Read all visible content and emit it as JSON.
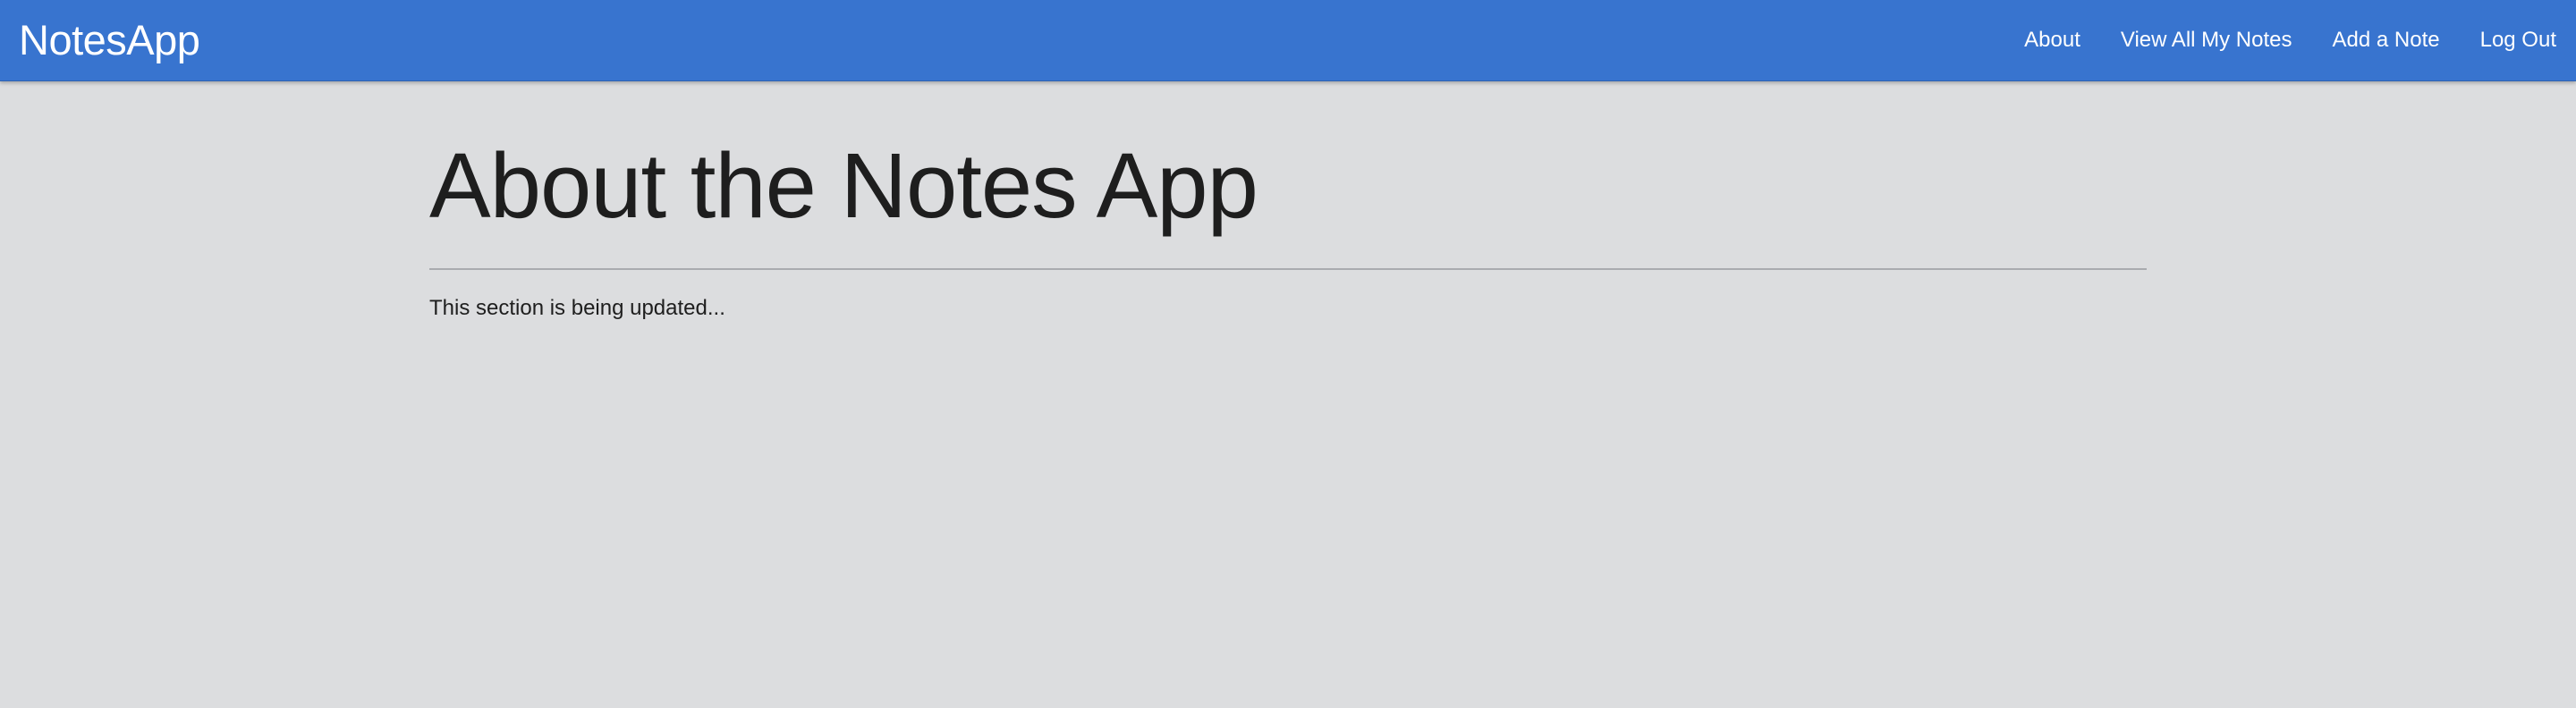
{
  "navbar": {
    "brand": "NotesApp",
    "links": [
      {
        "label": "About"
      },
      {
        "label": "View All My Notes"
      },
      {
        "label": "Add a Note"
      },
      {
        "label": "Log Out"
      }
    ]
  },
  "main": {
    "title": "About the Notes App",
    "body": "This section is being updated..."
  },
  "colors": {
    "navbar_background": "#3874cf",
    "page_background": "#dcdddf",
    "text": "#1e1e1e",
    "nav_text": "#ffffff"
  }
}
